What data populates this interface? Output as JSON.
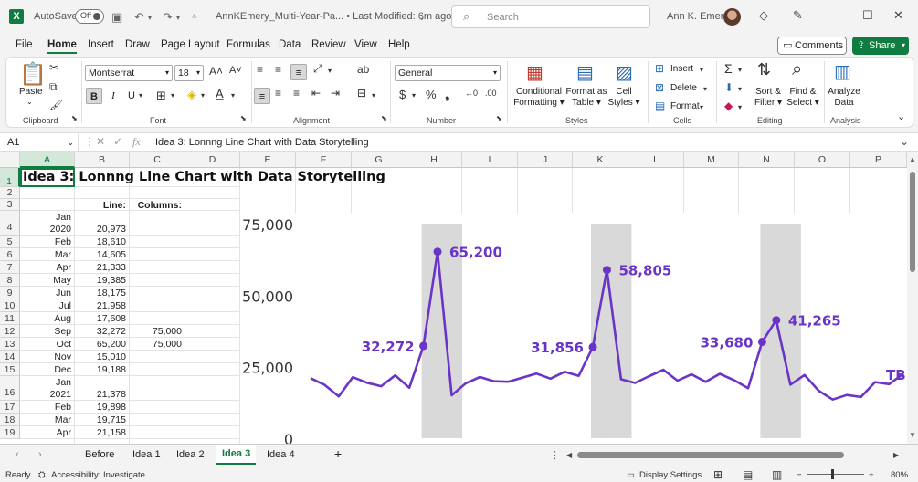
{
  "titlebar": {
    "autosave_label": "AutoSave",
    "autosave_state": "Off",
    "doc_title": "AnnKEmery_Multi-Year-Pa... • Last Modified: 6m ago",
    "search_placeholder": "Search",
    "user_name": "Ann K. Emery"
  },
  "ribbon_tabs": [
    "File",
    "Home",
    "Insert",
    "Draw",
    "Page Layout",
    "Formulas",
    "Data",
    "Review",
    "View",
    "Help"
  ],
  "active_tab": "Home",
  "actions": {
    "comments": "Comments",
    "share": "Share"
  },
  "ribbon": {
    "clipboard": {
      "label": "Clipboard",
      "paste": "Paste"
    },
    "font": {
      "label": "Font",
      "font_name": "Montserrat",
      "font_size": "18"
    },
    "alignment": {
      "label": "Alignment"
    },
    "number": {
      "label": "Number",
      "format": "General"
    },
    "styles": {
      "label": "Styles",
      "conditional": "Conditional",
      "formatting": "Formatting",
      "format_as": "Format as",
      "table": "Table",
      "cell": "Cell",
      "cell_styles": "Styles"
    },
    "cells": {
      "label": "Cells",
      "insert": "Insert",
      "delete": "Delete",
      "format": "Format"
    },
    "editing": {
      "label": "Editing",
      "sort": "Sort &",
      "filter": "Filter",
      "find": "Find &",
      "select": "Select"
    },
    "analysis": {
      "label": "Analysis",
      "analyze": "Analyze",
      "data": "Data"
    }
  },
  "formula_bar": {
    "name_box": "A1",
    "formula": "Idea 3: Lonnng Line Chart with Data Storytelling"
  },
  "grid": {
    "columns": [
      "A",
      "B",
      "C",
      "D",
      "E",
      "F",
      "G",
      "H",
      "I",
      "J",
      "K",
      "L",
      "M",
      "N",
      "O",
      "P"
    ],
    "rows": [
      "1",
      "2",
      "3",
      "4",
      "5",
      "6",
      "7",
      "8",
      "9",
      "10",
      "11",
      "12",
      "13",
      "14",
      "15",
      "16",
      "17",
      "18",
      "19"
    ],
    "title": "Idea 3: Lonnng Line Chart with Data Storytelling",
    "header_line": "Line:",
    "header_columns": "Columns:",
    "data_rows": [
      {
        "a1": "Jan",
        "a2": "2020",
        "b": "20,973",
        "c": ""
      },
      {
        "a1": "",
        "a2": "Feb",
        "b": "18,610",
        "c": ""
      },
      {
        "a1": "",
        "a2": "Mar",
        "b": "14,605",
        "c": ""
      },
      {
        "a1": "",
        "a2": "Apr",
        "b": "21,333",
        "c": ""
      },
      {
        "a1": "",
        "a2": "May",
        "b": "19,385",
        "c": ""
      },
      {
        "a1": "",
        "a2": "Jun",
        "b": "18,175",
        "c": ""
      },
      {
        "a1": "",
        "a2": "Jul",
        "b": "21,958",
        "c": ""
      },
      {
        "a1": "",
        "a2": "Aug",
        "b": "17,608",
        "c": ""
      },
      {
        "a1": "",
        "a2": "Sep",
        "b": "32,272",
        "c": "75,000"
      },
      {
        "a1": "",
        "a2": "Oct",
        "b": "65,200",
        "c": "75,000"
      },
      {
        "a1": "",
        "a2": "Nov",
        "b": "15,010",
        "c": ""
      },
      {
        "a1": "",
        "a2": "Dec",
        "b": "19,188",
        "c": ""
      },
      {
        "a1": "Jan",
        "a2": "2021",
        "b": "21,378",
        "c": ""
      },
      {
        "a1": "",
        "a2": "Feb",
        "b": "19,898",
        "c": ""
      },
      {
        "a1": "",
        "a2": "Mar",
        "b": "19,715",
        "c": ""
      },
      {
        "a1": "",
        "a2": "Apr",
        "b": "21,158",
        "c": ""
      }
    ]
  },
  "chart_data": {
    "type": "line",
    "ylim": [
      0,
      75000
    ],
    "yticks": [
      "75,000",
      "50,000",
      "25,000",
      "0"
    ],
    "ytick_values": [
      75000,
      50000,
      25000,
      0
    ],
    "line_color": "#6a35c6",
    "column_color": "#d9d9d9",
    "column_months": [
      8,
      9,
      20,
      21,
      32,
      33,
      44
    ],
    "values": [
      20973,
      18610,
      14605,
      21333,
      19385,
      18175,
      21958,
      17608,
      32272,
      65200,
      15010,
      19188,
      21378,
      19898,
      19715,
      21158,
      22600,
      20800,
      23200,
      21800,
      31856,
      58805,
      20600,
      19300,
      21700,
      23900,
      20100,
      22300,
      19700,
      22500,
      20300,
      17500,
      33680,
      41265,
      18700,
      22100,
      16600,
      13500,
      15100,
      14400,
      19600,
      18900,
      22500
    ],
    "annotations": [
      {
        "index": 8,
        "label": "32,272",
        "side": "left"
      },
      {
        "index": 9,
        "label": "65,200",
        "side": "right"
      },
      {
        "index": 20,
        "label": "31,856",
        "side": "left"
      },
      {
        "index": 21,
        "label": "58,805",
        "side": "right"
      },
      {
        "index": 32,
        "label": "33,680",
        "side": "left"
      },
      {
        "index": 33,
        "label": "41,265",
        "side": "right"
      }
    ],
    "trailing_label": "TB"
  },
  "sheets": [
    "Before",
    "Idea 1",
    "Idea 2",
    "Idea 3",
    "Idea 4"
  ],
  "active_sheet": "Idea 3",
  "status": {
    "ready": "Ready",
    "accessibility": "Accessibility: Investigate",
    "display_settings": "Display Settings",
    "zoom": "80%"
  }
}
